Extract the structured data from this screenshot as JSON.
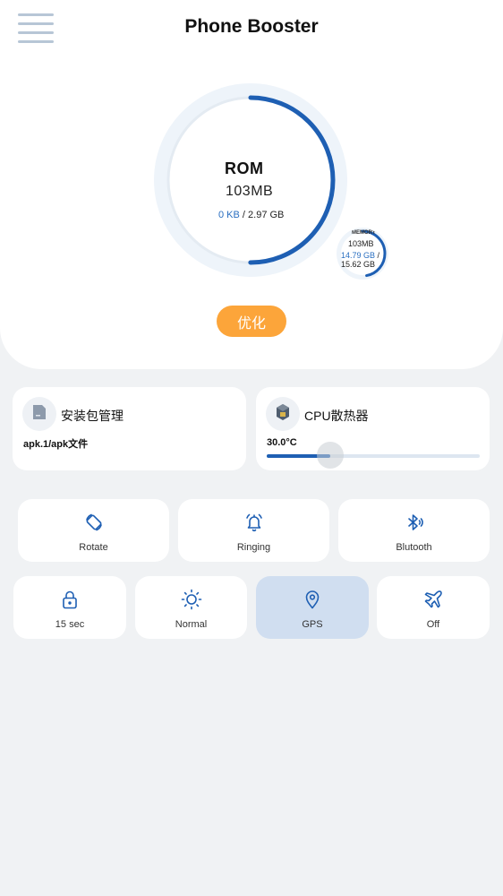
{
  "header": {
    "title": "Phone Booster",
    "menu_icon": "hamburger-menu-icon"
  },
  "rom": {
    "label": "ROM",
    "size": "103MB",
    "used": "0 KB",
    "separator": " / ",
    "total": "2.97 GB",
    "progress_fraction": 0.5
  },
  "ram": {
    "label": "MEMORY",
    "size": "103MB",
    "used": "14.79 GB",
    "separator": " / ",
    "total": "15.62 GB",
    "progress_fraction": 0.47
  },
  "optimize_button": {
    "label": "优化"
  },
  "apk_card": {
    "title": "安装包管理",
    "subtitle": "apk.1/apk文件",
    "icon": "apk-file-icon"
  },
  "cpu_card": {
    "title": "CPU散热器",
    "temperature": "30.0°C",
    "slider_fraction": 0.3,
    "icon": "cpu-chip-icon"
  },
  "quick_toggles": [
    {
      "label": "Rotate",
      "icon": "rotate-icon",
      "active": false
    },
    {
      "label": "Ringing",
      "icon": "bell-icon",
      "active": false
    },
    {
      "label": "Blutooth",
      "icon": "bluetooth-icon",
      "active": false
    },
    {
      "label": "15 sec",
      "icon": "lock-icon",
      "active": false
    },
    {
      "label": "Normal",
      "icon": "brightness-icon",
      "active": false
    },
    {
      "label": "GPS",
      "icon": "location-pin-icon",
      "active": true
    },
    {
      "label": "Off",
      "icon": "airplane-icon",
      "active": false
    }
  ],
  "colors": {
    "accent_blue": "#1e5fb3",
    "optimize_orange": "#fca53a",
    "active_tile": "#d0def0",
    "background": "#f0f2f4"
  }
}
